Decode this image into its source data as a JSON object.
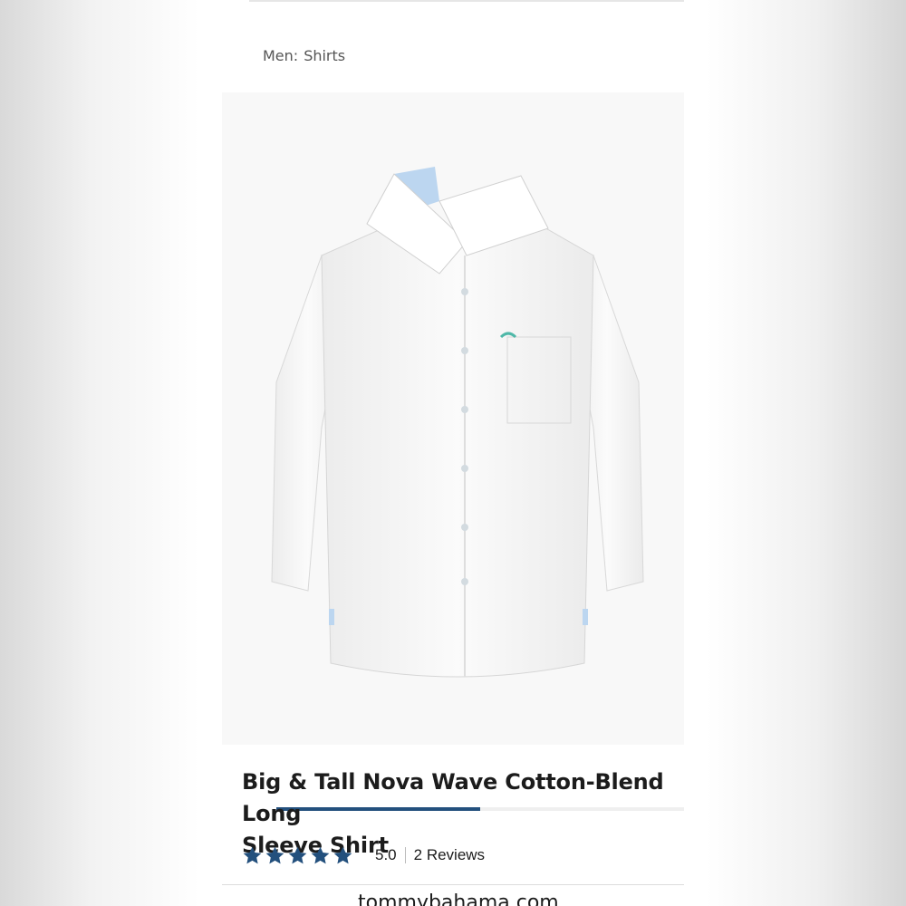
{
  "breadcrumb": {
    "parent": "Men:",
    "current": "Shirts"
  },
  "product": {
    "title_line1": "Big & Tall Nova Wave Cotton-Blend Long",
    "title_line2": "Sleeve Shirt",
    "rating": "5.0",
    "stars_filled": 5,
    "reviews": "2 Reviews",
    "image_alt": "White long sleeve shirt"
  },
  "carousel": {
    "progress": 0.5
  },
  "footer": {
    "site": "tommybahama.com"
  },
  "colors": {
    "accent": "#23507d",
    "star": "#23507d"
  },
  "icons": {
    "star": "star-icon"
  }
}
